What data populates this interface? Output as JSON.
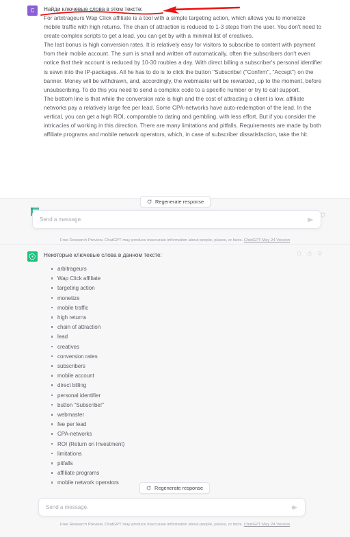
{
  "capture_one": {
    "user_message": {
      "avatar_initial": "C",
      "avatar_color": "#8b5fd6",
      "prompt": "Найди ключевые слова в этом тексте:",
      "paragraphs": [
        "For arbitrageurs Wap Click affiliate is a tool with a simple targeting action, which allows you to monetize mobile traffic with high returns. The chain of attraction is reduced to 1-3 steps from the user. You don't need to create complex scripts to get a lead, you can get by with a minimal list of creatives.",
        "The last bonus is high conversion rates. It is relatively easy for visitors to subscribe to content with payment from their mobile account. The sum is small and written off automatically, often the subscribers don't even notice that their account is reduced by 10-30 roubles a day. With direct billing a subscriber's personal identifier is sewn into the IP-packages. All he has to do is to click the button \"Subscribe! (\"Confirm\", \"Accept\") on the banner. Money will be withdrawn, and, accordingly, the webmaster will be rewarded, up to the moment, before unsubscribing. To do this you need to send a complex code to a specific number or try to call support.",
        "The bottom line is that while the conversion rate is high and the cost of attracting a client is low, affiliate networks pay a relatively large fee per lead. Some CPA-networks have auto-redemption of the lead. In the vertical, you can get a high ROI, comparable to dating and gembling, with less effort. But if you consider the intricacies of working in this direction. There are many limitations and pitfalls. Requirements are made by both affiliate programs and mobile network operators, which, in case of subscriber dissatisfaction, take the hit."
      ]
    },
    "regenerate_label": "Regenerate response",
    "composer_placeholder": "Send a message.",
    "footer_text": "Free Research Preview. ChatGPT may produce inaccurate information about people, places, or facts.",
    "footer_link": "ChatGPT May 24 Version"
  },
  "capture_two": {
    "bot_message": {
      "intro": "Некоторые ключевые слова в данном тексте:",
      "keywords": [
        "arbitrageurs",
        "Wap Click affiliate",
        "targeting action",
        "monetize",
        "mobile traffic",
        "high returns",
        "chain of attraction",
        "lead",
        "creatives",
        "conversion rates",
        "subscribers",
        "mobile account",
        "direct billing",
        "personal identifier",
        "button \"Subscribe!\"",
        "webmaster",
        "fee per lead",
        "CPA-networks",
        "ROI (Return on Investment)",
        "limitations",
        "pitfalls",
        "affiliate programs",
        "mobile network operators"
      ]
    },
    "actions": {
      "copy": "copy-icon",
      "thumbs_up": "thumbs-up-icon",
      "thumbs_down": "thumbs-down-icon"
    },
    "regenerate_label": "Regenerate response",
    "composer_placeholder": "Send a message.",
    "footer_text": "Free Research Preview. ChatGPT may produce inaccurate information about people, places, or facts.",
    "footer_link": "ChatGPT May 24 Version"
  },
  "annotation": {
    "color": "#ee1111",
    "type": "arrow-and-underline"
  }
}
